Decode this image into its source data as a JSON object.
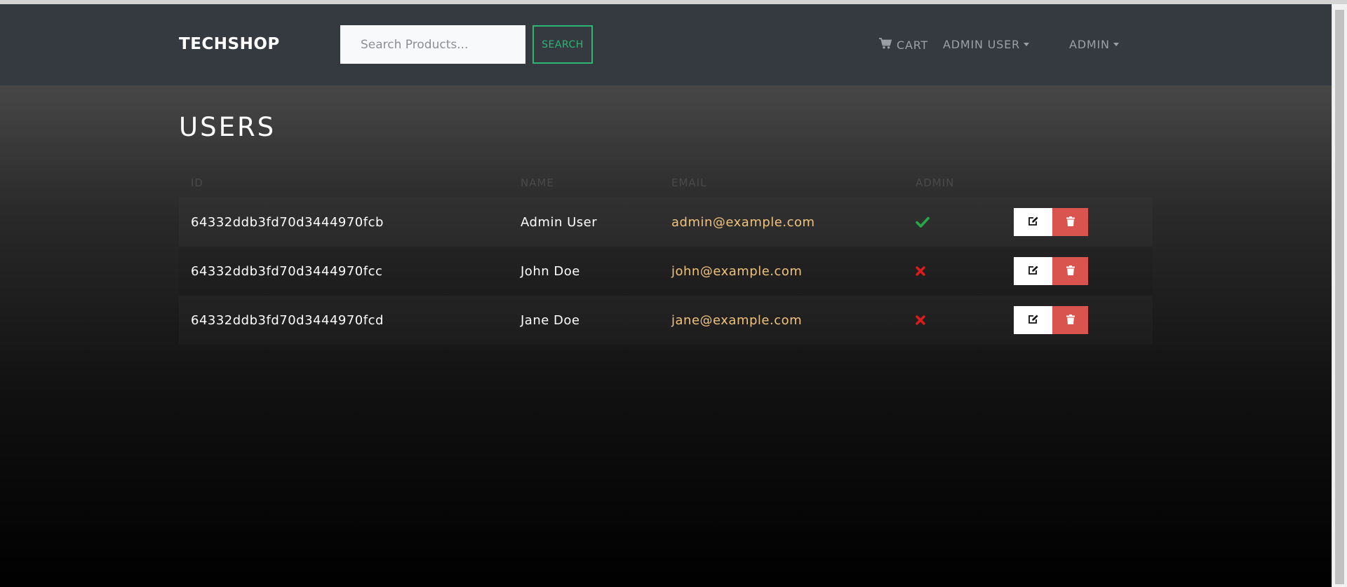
{
  "navbar": {
    "brand": "TECHSHOP",
    "search_placeholder": "Search Products...",
    "search_label": "SEARCH",
    "cart_label": "CART",
    "user_menu_label": "ADMIN USER",
    "admin_menu_label": "ADMIN"
  },
  "page": {
    "title": "USERS"
  },
  "table": {
    "headers": {
      "id": "ID",
      "name": "NAME",
      "email": "EMAIL",
      "admin": "ADMIN"
    },
    "rows": [
      {
        "id": "64332ddb3fd70d3444970fcb",
        "name": "Admin User",
        "email": "admin@example.com",
        "is_admin": true
      },
      {
        "id": "64332ddb3fd70d3444970fcc",
        "name": "John Doe",
        "email": "john@example.com",
        "is_admin": false
      },
      {
        "id": "64332ddb3fd70d3444970fcd",
        "name": "Jane Doe",
        "email": "jane@example.com",
        "is_admin": false
      }
    ]
  },
  "icons": {
    "cart": "shopping-cart-icon",
    "admin_true": "check-icon",
    "admin_false": "cross-icon",
    "edit": "edit-icon",
    "delete": "trash-icon"
  },
  "colors": {
    "navbar_bg": "#343a40",
    "search_accent": "#2bb673",
    "email_link": "#f0c27b",
    "admin_yes": "#28a745",
    "admin_no": "#e01b1b",
    "delete_button": "#d9534f"
  }
}
